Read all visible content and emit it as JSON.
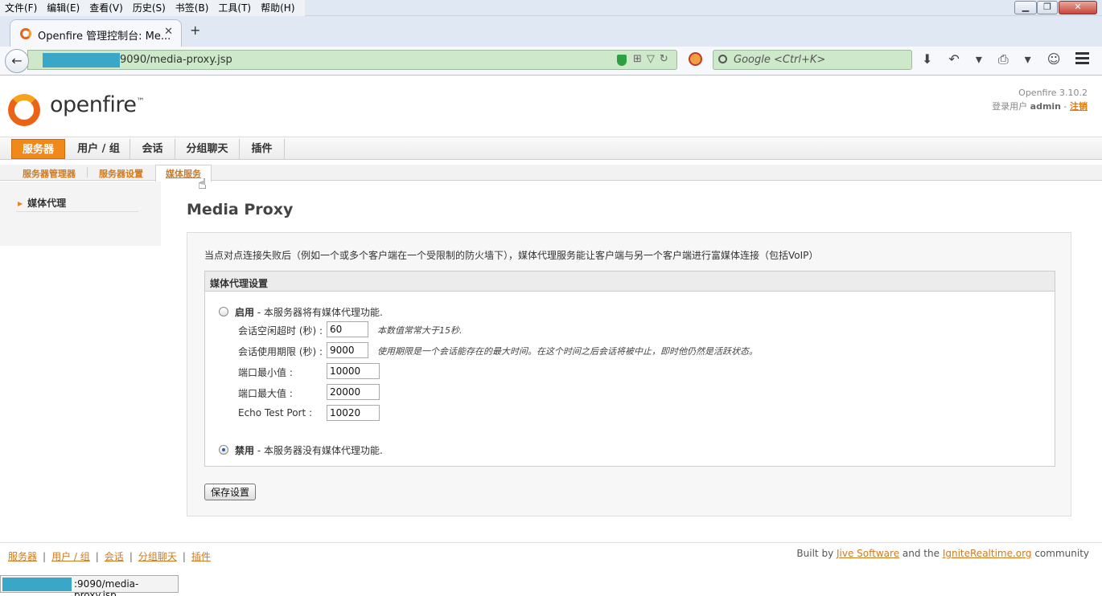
{
  "browser": {
    "menu": [
      "文件(F)",
      "编辑(E)",
      "查看(V)",
      "历史(S)",
      "书签(B)",
      "工具(T)",
      "帮助(H)"
    ],
    "window_controls": {
      "minimize": "▁",
      "maximize": "❐",
      "close": "✕"
    },
    "tab": {
      "title": "Openfire 管理控制台: Me...",
      "close": "✕"
    },
    "new_tab": "+",
    "back": "←",
    "url_suffix": "9090/media-proxy.jsp",
    "url_icons": "⊞▽↻",
    "search_placeholder": "Google <Ctrl+K>",
    "toolbar_icons": [
      "⬇",
      "↶",
      "▾",
      "⎙",
      "▾",
      "☺"
    ]
  },
  "header": {
    "logo_text": "openfire",
    "logo_tm": "™",
    "version": "Openfire 3.10.2",
    "logged_in_prefix": "登录用户",
    "user": "admin",
    "logout": "注销"
  },
  "main_nav": [
    "服务器",
    "用户 / 组",
    "会话",
    "分组聊天",
    "插件"
  ],
  "sub_nav": [
    "服务器管理器",
    "服务器设置",
    "媒体服务"
  ],
  "sidebar": {
    "item": "媒体代理",
    "arrow": "▶"
  },
  "content": {
    "title": "Media Proxy",
    "intro": "当点对点连接失败后（例如一个或多个客户端在一个受限制的防火墙下），媒体代理服务能让客户端与另一个客户端进行富媒体连接（包括VoIP）",
    "section_title": "媒体代理设置",
    "enable": {
      "label": "启用",
      "desc": " - 本服务器将有媒体代理功能."
    },
    "disable": {
      "label": "禁用",
      "desc": " - 本服务器没有媒体代理功能."
    },
    "fields": [
      {
        "label": "会话空闲超时 (秒) :",
        "value": "60",
        "hint": "本数值常常大于15秒."
      },
      {
        "label": "会话使用期限 (秒) :",
        "value": "9000",
        "hint": "使用期限是一个会话能存在的最大时间。在这个时间之后会话将被中止，即时他仍然是活跃状态。"
      },
      {
        "label": "端口最小值 :",
        "value": "10000",
        "hint": ""
      },
      {
        "label": "端口最大值 :",
        "value": "20000",
        "hint": ""
      },
      {
        "label": "Echo Test Port :",
        "value": "10020",
        "hint": ""
      }
    ],
    "save_button": "保存设置"
  },
  "footer": {
    "links": [
      "服务器",
      "用户 / 组",
      "会话",
      "分组聊天",
      "插件"
    ],
    "separator": "|",
    "built_by_prefix": "Built by",
    "jive": "Jive Software",
    "and_the": "and the",
    "ignite": "IgniteRealtime.org",
    "community": "community"
  },
  "status_bar": {
    "url_suffix": ":9090/media-proxy.jsp"
  },
  "colors": {
    "accent": "#f0881a",
    "link": "#d07a20",
    "url_bg": "#cde9c9",
    "redaction": "#3aa6c8"
  }
}
